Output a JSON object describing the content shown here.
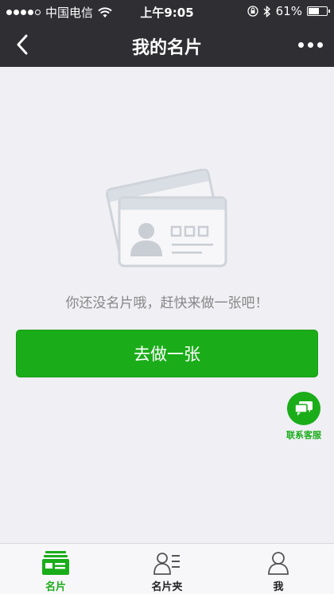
{
  "status_bar": {
    "carrier": "中国电信",
    "time": "上午9:05",
    "battery": "61%",
    "battery_level": 0.61
  },
  "nav": {
    "title": "我的名片"
  },
  "empty_state": {
    "message": "你还没名片哦，赶快来做一张吧！",
    "button_label": "去做一张"
  },
  "contact_service": {
    "label": "联系客服"
  },
  "tabs": [
    {
      "label": "名片",
      "icon": "card-icon",
      "active": true
    },
    {
      "label": "名片夹",
      "icon": "card-holder-icon",
      "active": false
    },
    {
      "label": "我",
      "icon": "me-icon",
      "active": false
    }
  ],
  "colors": {
    "accent": "#1aad19",
    "nav_background": "#2e2e33",
    "page_background": "#efeff4"
  }
}
